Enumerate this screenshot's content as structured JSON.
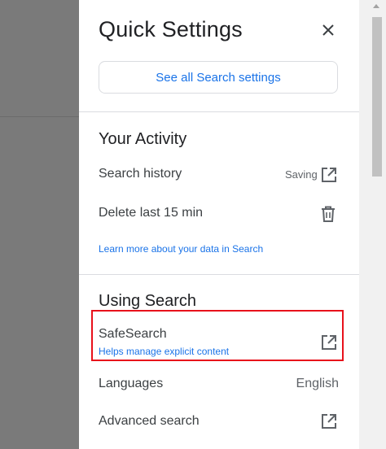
{
  "panel": {
    "title": "Quick Settings",
    "see_all_label": "See all Search settings"
  },
  "your_activity": {
    "title": "Your Activity",
    "search_history_label": "Search history",
    "search_history_status": "Saving",
    "delete_label": "Delete last 15 min",
    "learn_more_link": "Learn more about your data in Search"
  },
  "using_search": {
    "title": "Using Search",
    "safesearch_label": "SafeSearch",
    "safesearch_sub": "Helps manage explicit content",
    "languages_label": "Languages",
    "languages_value": "English",
    "advanced_label": "Advanced search"
  },
  "icons": {
    "close": "close-icon",
    "open_in_new": "open-in-new-icon",
    "trash": "trash-icon"
  },
  "colors": {
    "accent": "#1a73e8",
    "highlight": "#e8111b",
    "backdrop": "#7a7a7a"
  }
}
